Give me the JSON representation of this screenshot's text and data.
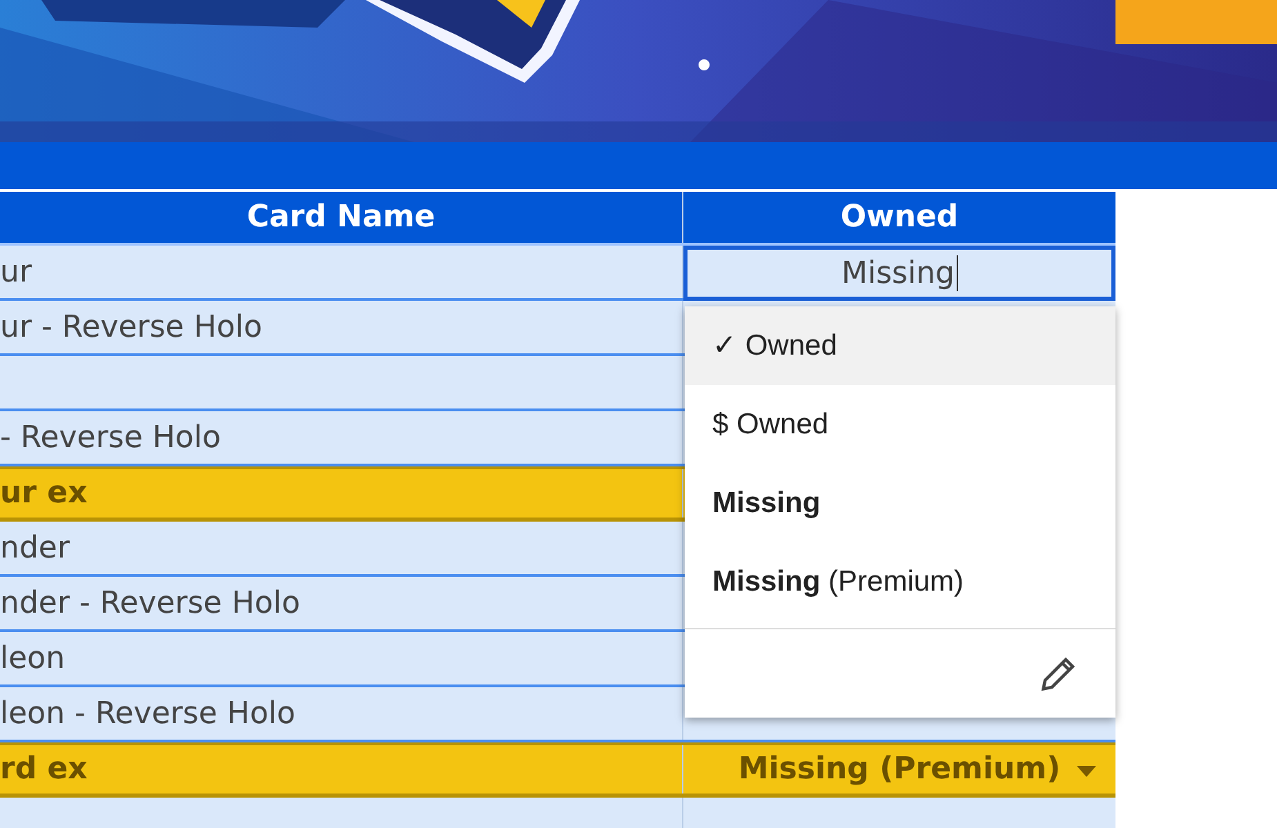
{
  "table": {
    "columns": [
      "Card Name",
      "Owned"
    ],
    "rows": [
      {
        "kind": "normal",
        "name": "ur"
      },
      {
        "kind": "normal",
        "name": "ur - Reverse Holo"
      },
      {
        "kind": "normal",
        "name": ""
      },
      {
        "kind": "normal",
        "name": "- Reverse Holo"
      },
      {
        "kind": "ex",
        "name": "ur ex"
      },
      {
        "kind": "normal",
        "name": "nder"
      },
      {
        "kind": "normal",
        "name": "nder - Reverse Holo"
      },
      {
        "kind": "normal",
        "name": "leon"
      },
      {
        "kind": "normal",
        "name": "leon - Reverse Holo"
      },
      {
        "kind": "ex",
        "name": "rd ex",
        "owned": "Missing (Premium)"
      },
      {
        "kind": "normal",
        "name": ""
      }
    ]
  },
  "editor": {
    "value": "Missing"
  },
  "menu": {
    "items": [
      {
        "label": "✓ Owned",
        "bold": false,
        "selected": true
      },
      {
        "label": "$ Owned",
        "bold": false,
        "selected": false
      },
      {
        "label": "Missing",
        "bold": true,
        "selected": false
      },
      {
        "label": "**Missing** (Premium)",
        "bold": false,
        "selected": false
      }
    ]
  }
}
